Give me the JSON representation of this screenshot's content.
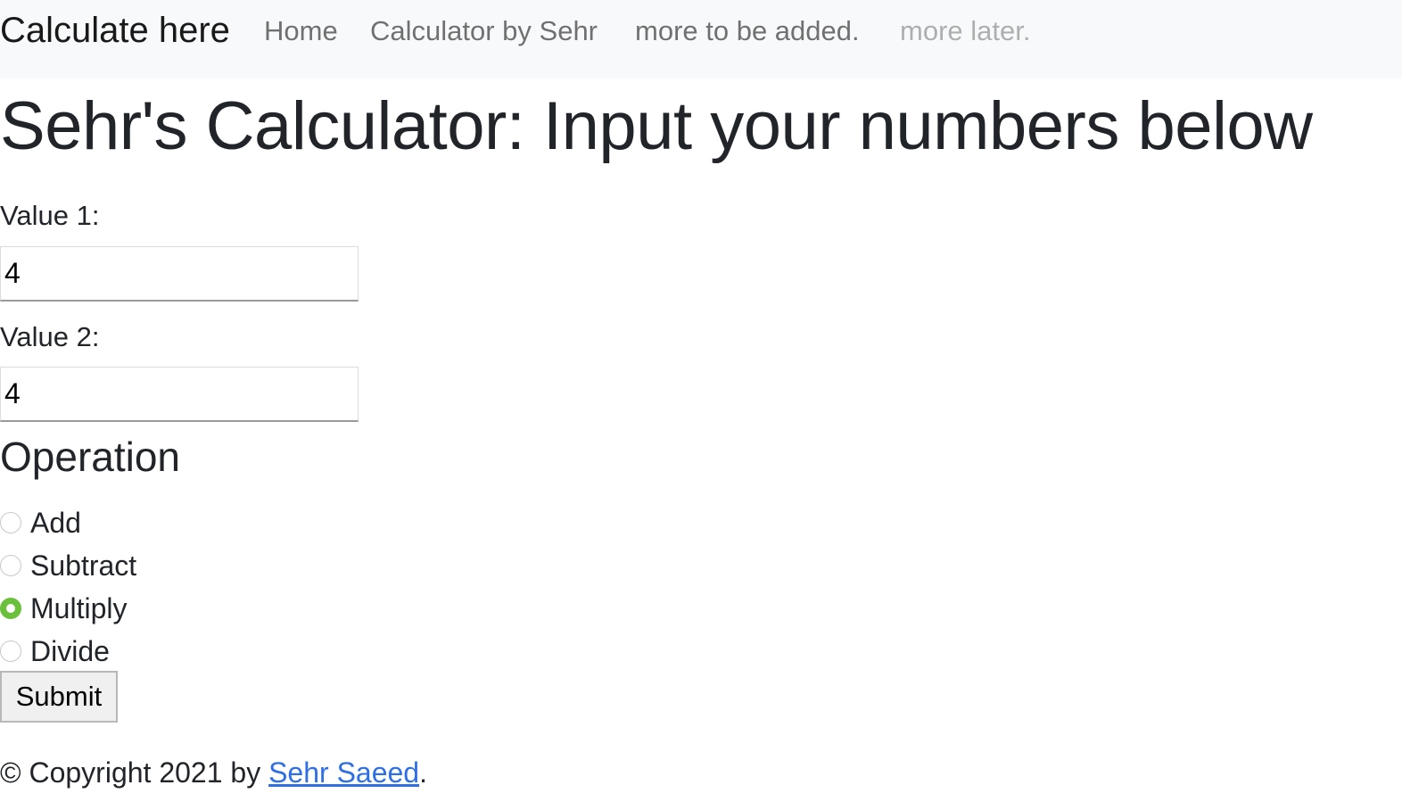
{
  "navbar": {
    "brand": "Calculate here",
    "links": [
      {
        "label": "Home",
        "disabled": false
      },
      {
        "label": "Calculator by Sehr",
        "disabled": false
      },
      {
        "label": "more to be added.",
        "disabled": false
      },
      {
        "label": "more later.",
        "disabled": true
      }
    ]
  },
  "page": {
    "title": "Sehr's Calculator: Input your numbers below"
  },
  "form": {
    "value1": {
      "label": "Value 1:",
      "value": "4"
    },
    "value2": {
      "label": "Value 2:",
      "value": "4"
    },
    "operation": {
      "title": "Operation",
      "options": [
        {
          "label": "Add",
          "checked": false
        },
        {
          "label": "Subtract",
          "checked": false
        },
        {
          "label": "Multiply",
          "checked": true
        },
        {
          "label": "Divide",
          "checked": false
        }
      ],
      "selected": "Multiply"
    },
    "submit_label": "Submit"
  },
  "footer": {
    "prefix": "© Copyright 2021 by ",
    "author_link": "Sehr Saeed",
    "suffix": "."
  },
  "colors": {
    "navbar_bg": "#f8f9fa",
    "text": "#212529",
    "link": "#2f6fe4",
    "radio_checked": "#6abf3b"
  }
}
